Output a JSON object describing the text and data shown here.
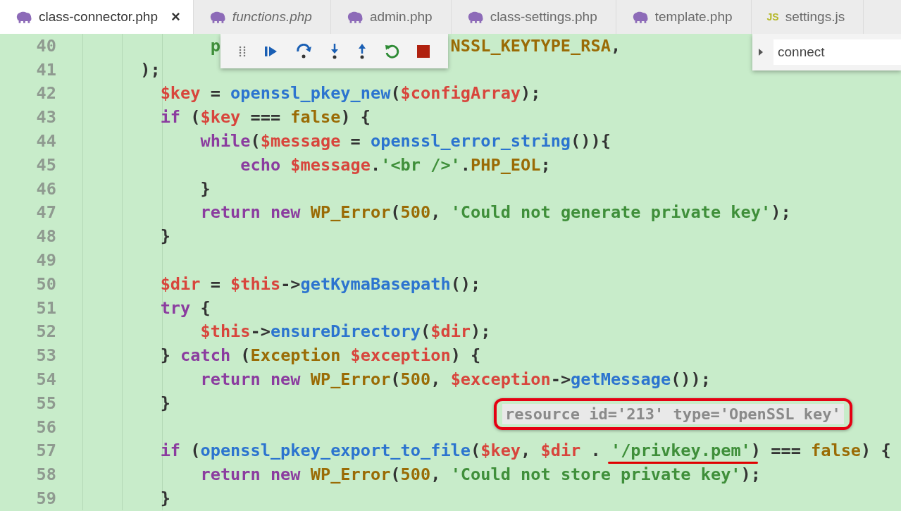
{
  "tabs": [
    {
      "label": "class-connector.php",
      "kind": "php",
      "selected": true,
      "italic": false,
      "close": "×"
    },
    {
      "label": "functions.php",
      "kind": "php",
      "selected": false,
      "italic": true
    },
    {
      "label": "admin.php",
      "kind": "php",
      "selected": false,
      "italic": false
    },
    {
      "label": "class-settings.php",
      "kind": "php",
      "selected": false,
      "italic": false
    },
    {
      "label": "template.php",
      "kind": "php",
      "selected": false,
      "italic": false
    },
    {
      "label": "settings.js",
      "kind": "js",
      "badge": "JS",
      "selected": false,
      "italic": false
    }
  ],
  "debug_toolbar": {
    "buttons": [
      {
        "kind": "continue"
      },
      {
        "kind": "step-over"
      },
      {
        "kind": "step-into"
      },
      {
        "kind": "step-out"
      },
      {
        "kind": "restart"
      },
      {
        "kind": "stop"
      }
    ]
  },
  "find_widget": {
    "value": "connect",
    "expanded": false
  },
  "editor": {
    "lines": [
      {
        "num": "40",
        "fragments": [
          [
            {
              "text": "             p",
              "kind": "string"
            }
          ],
          [
            {
              "text": "                       NSSL_KEYTYPE_RSA",
              "kind": "constant"
            },
            {
              "text": ",",
              "kind": "punct"
            }
          ]
        ]
      },
      {
        "num": "41",
        "tokens": [
          {
            "text": "      );",
            "kind": "punct"
          }
        ]
      },
      {
        "num": "42",
        "tokens": [
          {
            "text": "        $key",
            "kind": "variable"
          },
          {
            "text": " = ",
            "kind": "punct"
          },
          {
            "text": "openssl_pkey_new",
            "kind": "function"
          },
          {
            "text": "(",
            "kind": "punct"
          },
          {
            "text": "$configArray",
            "kind": "variable"
          },
          {
            "text": ");",
            "kind": "punct"
          }
        ]
      },
      {
        "num": "43",
        "tokens": [
          {
            "text": "        if",
            "kind": "keyword"
          },
          {
            "text": " (",
            "kind": "punct"
          },
          {
            "text": "$key",
            "kind": "variable"
          },
          {
            "text": " === ",
            "kind": "punct"
          },
          {
            "text": "false",
            "kind": "constant"
          },
          {
            "text": ") {",
            "kind": "punct"
          }
        ]
      },
      {
        "num": "44",
        "tokens": [
          {
            "text": "            while",
            "kind": "keyword"
          },
          {
            "text": "(",
            "kind": "punct"
          },
          {
            "text": "$message",
            "kind": "variable"
          },
          {
            "text": " = ",
            "kind": "punct"
          },
          {
            "text": "openssl_error_string",
            "kind": "function"
          },
          {
            "text": "()){",
            "kind": "punct"
          }
        ]
      },
      {
        "num": "45",
        "tokens": [
          {
            "text": "                echo",
            "kind": "keyword"
          },
          {
            "text": " $message",
            "kind": "variable"
          },
          {
            "text": ".",
            "kind": "punct"
          },
          {
            "text": "'<br />'",
            "kind": "string"
          },
          {
            "text": ".",
            "kind": "punct"
          },
          {
            "text": "PHP_EOL",
            "kind": "constant"
          },
          {
            "text": ";",
            "kind": "punct"
          }
        ]
      },
      {
        "num": "46",
        "tokens": [
          {
            "text": "            }",
            "kind": "punct"
          }
        ]
      },
      {
        "num": "47",
        "tokens": [
          {
            "text": "            return new",
            "kind": "keyword"
          },
          {
            "text": " WP_Error",
            "kind": "constant"
          },
          {
            "text": "(",
            "kind": "punct"
          },
          {
            "text": "500",
            "kind": "number"
          },
          {
            "text": ", ",
            "kind": "punct"
          },
          {
            "text": "'Could not generate private key'",
            "kind": "string"
          },
          {
            "text": ");",
            "kind": "punct"
          }
        ]
      },
      {
        "num": "48",
        "tokens": [
          {
            "text": "        }",
            "kind": "punct"
          }
        ]
      },
      {
        "num": "49"
      },
      {
        "num": "50",
        "tokens": [
          {
            "text": "        $dir",
            "kind": "variable"
          },
          {
            "text": " = ",
            "kind": "punct"
          },
          {
            "text": "$this",
            "kind": "variable"
          },
          {
            "text": "->",
            "kind": "punct"
          },
          {
            "text": "getKymaBasepath",
            "kind": "function"
          },
          {
            "text": "();",
            "kind": "punct"
          }
        ]
      },
      {
        "num": "51",
        "tokens": [
          {
            "text": "        try",
            "kind": "keyword"
          },
          {
            "text": " {",
            "kind": "punct"
          }
        ]
      },
      {
        "num": "52",
        "tokens": [
          {
            "text": "            $this",
            "kind": "variable"
          },
          {
            "text": "->",
            "kind": "punct"
          },
          {
            "text": "ensureDirectory",
            "kind": "function"
          },
          {
            "text": "(",
            "kind": "punct"
          },
          {
            "text": "$dir",
            "kind": "variable"
          },
          {
            "text": ");",
            "kind": "punct"
          }
        ]
      },
      {
        "num": "53",
        "tokens": [
          {
            "text": "        } ",
            "kind": "punct"
          },
          {
            "text": "catch",
            "kind": "keyword"
          },
          {
            "text": " (",
            "kind": "punct"
          },
          {
            "text": "Exception",
            "kind": "constant"
          },
          {
            "text": " $exception",
            "kind": "variable"
          },
          {
            "text": ") {",
            "kind": "punct"
          }
        ]
      },
      {
        "num": "54",
        "tokens": [
          {
            "text": "            return new",
            "kind": "keyword"
          },
          {
            "text": " WP_Error",
            "kind": "constant"
          },
          {
            "text": "(",
            "kind": "punct"
          },
          {
            "text": "500",
            "kind": "number"
          },
          {
            "text": ", ",
            "kind": "punct"
          },
          {
            "text": "$exception",
            "kind": "variable"
          },
          {
            "text": "->",
            "kind": "punct"
          },
          {
            "text": "getMessage",
            "kind": "function"
          },
          {
            "text": "());",
            "kind": "punct"
          }
        ]
      },
      {
        "num": "55",
        "tokens": [
          {
            "text": "        }",
            "kind": "punct"
          }
        ]
      },
      {
        "num": "56"
      },
      {
        "num": "57",
        "tokens": [
          {
            "text": "        if",
            "kind": "keyword"
          },
          {
            "text": " (",
            "kind": "punct"
          },
          {
            "text": "openssl_pkey_export_to_file",
            "kind": "function"
          },
          {
            "text": "(",
            "kind": "punct"
          },
          {
            "text": "$key",
            "kind": "variable"
          },
          {
            "text": ", ",
            "kind": "punct"
          },
          {
            "text": "$dir",
            "kind": "variable"
          },
          {
            "text": " . ",
            "kind": "punct"
          },
          {
            "text": "'/privkey.pem'",
            "kind": "string",
            "underlined": true
          },
          {
            "text": ") === ",
            "kind": "punct"
          },
          {
            "text": "false",
            "kind": "constant"
          },
          {
            "text": ") {",
            "kind": "punct"
          }
        ]
      },
      {
        "num": "58",
        "tokens": [
          {
            "text": "            return new",
            "kind": "keyword"
          },
          {
            "text": " WP_Error",
            "kind": "constant"
          },
          {
            "text": "(",
            "kind": "punct"
          },
          {
            "text": "500",
            "kind": "number"
          },
          {
            "text": ", ",
            "kind": "punct"
          },
          {
            "text": "'Could not store private key'",
            "kind": "string"
          },
          {
            "text": ");",
            "kind": "punct"
          }
        ]
      },
      {
        "num": "59",
        "tokens": [
          {
            "text": "        }",
            "kind": "punct"
          }
        ]
      }
    ]
  },
  "hover_tooltip": {
    "text": "resource id='213' type='OpenSSL key'",
    "highlighted": true
  }
}
